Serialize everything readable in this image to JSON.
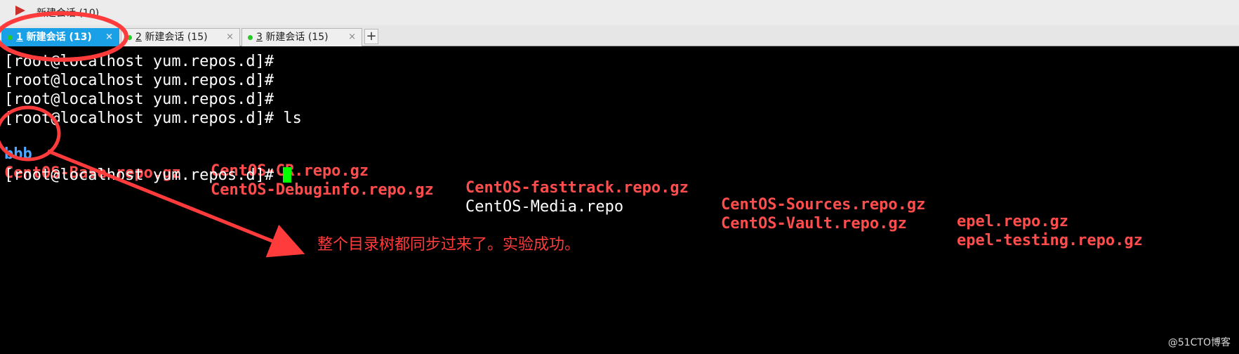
{
  "window": {
    "title": "新建会话 (10)"
  },
  "tabs": [
    {
      "number": "1",
      "label": " 新建会话 (13)",
      "active": true
    },
    {
      "number": "2",
      "label": " 新建会话 (15)",
      "active": false
    },
    {
      "number": "3",
      "label": " 新建会话 (15)",
      "active": false
    }
  ],
  "tab_close_glyph": "×",
  "new_tab_glyph": "+",
  "terminal": {
    "prompt": "[root@localhost yum.repos.d]#",
    "command": " ls",
    "listing": {
      "row1": [
        "bbb",
        "CentOS-CR.repo.gz",
        "CentOS-fasttrack.repo.gz",
        "CentOS-Sources.repo.gz",
        "epel.repo.gz"
      ],
      "row2": [
        "CentOS-Base.repo.gz",
        "CentOS-Debuginfo.repo.gz",
        "CentOS-Media.repo",
        "CentOS-Vault.repo.gz",
        "epel-testing.repo.gz"
      ]
    }
  },
  "annotation": {
    "text": "整个目录树都同步过来了。实验成功。"
  },
  "watermark": "@51CTO博客",
  "colors": {
    "directory": "#4fa8ff",
    "archive": "#ff4d4d",
    "cursor": "#00ff00",
    "annotation": "#ff3b3b",
    "active_tab": "#1aa0e6"
  }
}
